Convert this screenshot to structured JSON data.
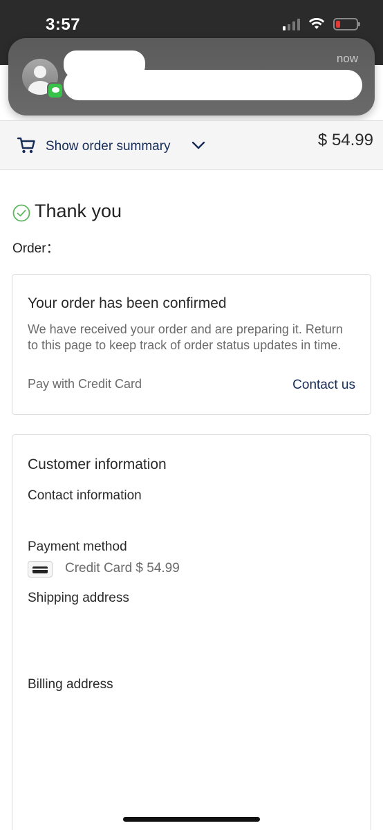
{
  "status_bar": {
    "time": "3:57",
    "icons": [
      "cellular-signal-icon",
      "wifi-icon",
      "battery-icon"
    ],
    "battery_color": "#e53935"
  },
  "notification": {
    "time": "now",
    "app_icon": "messages-icon"
  },
  "order_summary": {
    "label": "Show order summary",
    "total": "$ 54.99",
    "icons": [
      "cart-icon",
      "chevron-down-icon"
    ],
    "accent_color": "#172b57"
  },
  "confirmation": {
    "title": "Thank you",
    "order_label": "Order：",
    "check_color": "#5cb85c"
  },
  "status_card": {
    "title": "Your order has been confirmed",
    "description": "We have received your order and are preparing it. Return to this page to keep track of order status updates in time.",
    "payment_note": "Pay with Credit Card",
    "contact_link": "Contact us"
  },
  "customer_card": {
    "title": "Customer information",
    "contact_label": "Contact information",
    "payment_label": "Payment method",
    "payment_value": "Credit Card $ 54.99",
    "shipping_label": "Shipping address",
    "billing_label": "Billing address"
  }
}
